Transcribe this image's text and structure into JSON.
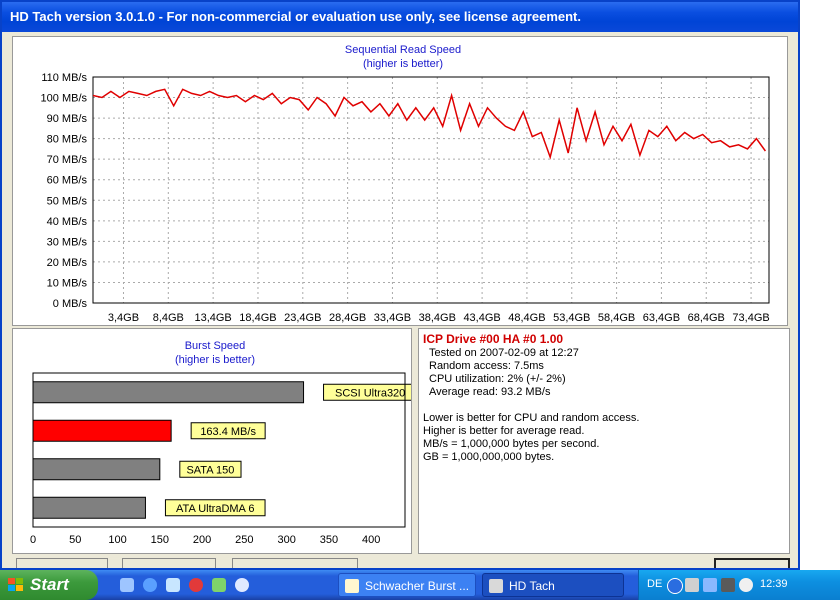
{
  "window": {
    "title": "HD Tach version 3.0.1.0  - For non-commercial or evaluation use only, see license agreement."
  },
  "seq_chart_data": {
    "type": "line",
    "title": "Sequential Read Speed",
    "subtitle": "(higher is better)",
    "ylim": [
      0,
      110
    ],
    "y_ticks": [
      "0 MB/s",
      "10 MB/s",
      "20 MB/s",
      "30 MB/s",
      "40 MB/s",
      "50 MB/s",
      "60 MB/s",
      "70 MB/s",
      "80 MB/s",
      "90 MB/s",
      "100 MB/s",
      "110 MB/s"
    ],
    "x_ticks": [
      "3,4GB",
      "8,4GB",
      "13,4GB",
      "18,4GB",
      "23,4GB",
      "28,4GB",
      "33,4GB",
      "38,4GB",
      "43,4GB",
      "48,4GB",
      "53,4GB",
      "58,4GB",
      "63,4GB",
      "68,4GB",
      "73,4GB"
    ],
    "xlim": [
      0,
      75.4
    ],
    "grid": true,
    "line_color": "#e00000",
    "series": [
      {
        "x": [
          0,
          1,
          2,
          3,
          4,
          5,
          6,
          7,
          8,
          9,
          10,
          11,
          12,
          13,
          14,
          15,
          16,
          17,
          18,
          19,
          20,
          21,
          22,
          23,
          24,
          25,
          26,
          27,
          28,
          29,
          30,
          31,
          32,
          33,
          34,
          35,
          36,
          37,
          38,
          39,
          40,
          41,
          42,
          43,
          44,
          45,
          46,
          47,
          48,
          49,
          50,
          51,
          52,
          53,
          54,
          55,
          56,
          57,
          58,
          59,
          60,
          61,
          62,
          63,
          64,
          65,
          66,
          67,
          68,
          69,
          70,
          71,
          72,
          73,
          74,
          75
        ],
        "values": [
          101,
          100,
          103,
          100,
          103,
          102,
          101,
          103,
          104,
          96,
          104,
          102,
          101,
          103,
          101,
          100,
          101,
          98,
          101,
          99,
          102,
          97,
          100,
          99,
          94,
          100,
          97,
          91,
          100,
          96,
          98,
          93,
          97,
          91,
          97,
          89,
          95,
          89,
          95,
          86,
          101,
          84,
          97,
          86,
          95,
          90,
          86,
          84,
          93,
          81,
          83,
          71,
          89,
          73,
          95,
          79,
          93,
          77,
          86,
          79,
          87,
          72,
          84,
          81,
          86,
          79,
          83,
          80,
          82,
          78,
          79,
          76,
          77,
          75,
          80,
          74
        ]
      }
    ]
  },
  "burst_chart_data": {
    "type": "bar",
    "title": "Burst Speed",
    "subtitle": "(higher is better)",
    "categories": [
      "SCSI Ultra320",
      "163.4 MB/s",
      "SATA 150",
      "ATA UltraDMA 6"
    ],
    "values": [
      320,
      163.4,
      150,
      133
    ],
    "bar_colors": [
      "#808080",
      "#ff0000",
      "#808080",
      "#808080"
    ],
    "xlim": [
      0,
      440
    ],
    "x_ticks": [
      "0",
      "50",
      "100",
      "150",
      "200",
      "250",
      "300",
      "350",
      "400"
    ]
  },
  "info": {
    "title": "ICP Drive #00 HA #0 1.00",
    "tested_on": "Tested on 2007-02-09 at 12:27",
    "random_access": "Random access: 7.5ms",
    "cpu": "CPU utilization: 2% (+/- 2%)",
    "average_read": "Average read: 93.2 MB/s",
    "note1": "Lower is better for CPU and random access.",
    "note2": "Higher is better for average read.",
    "note3": "MB/s = 1,000,000 bytes per second.",
    "note4": "GB = 1,000,000,000 bytes."
  },
  "taskbar": {
    "start_label": "Start",
    "tasks": [
      "Schwacher Burst ...",
      "HD Tach"
    ],
    "language": "DE",
    "clock": "12:39"
  }
}
